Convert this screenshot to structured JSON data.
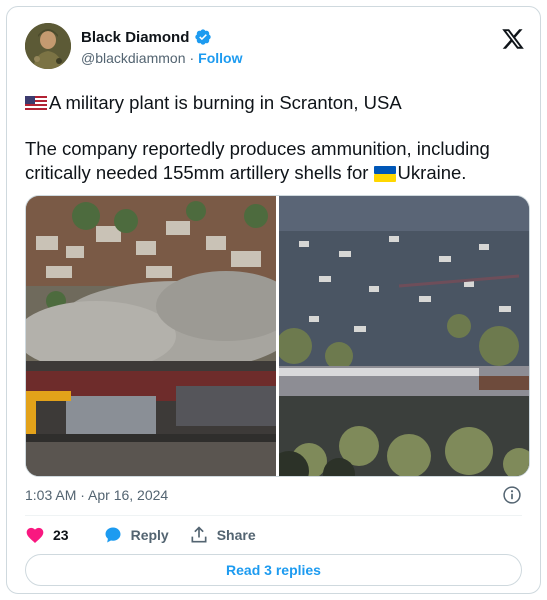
{
  "author": {
    "name": "Black Diamond",
    "handle": "@blackdiammon",
    "separator": "·",
    "follow_label": "Follow"
  },
  "tweet": {
    "line1": "A military plant is burning in Scranton, USA",
    "line2": "The company reportedly produces ammunition, including critically needed 155mm artillery shells for",
    "line2_tail": "Ukraine."
  },
  "timestamp": "1:03 AM · Apr 16, 2024",
  "actions": {
    "like_count": "23",
    "reply_label": "Reply",
    "share_label": "Share"
  },
  "read_replies_label": "Read 3 replies",
  "colors": {
    "accent": "#1d9bf0",
    "like": "#f91880",
    "text": "#0f1419",
    "muted": "#536471"
  },
  "icons": [
    "verified-badge-icon",
    "x-logo-icon",
    "us-flag-icon",
    "ukraine-flag-icon",
    "info-icon",
    "heart-icon",
    "reply-bubble-icon",
    "share-icon"
  ]
}
